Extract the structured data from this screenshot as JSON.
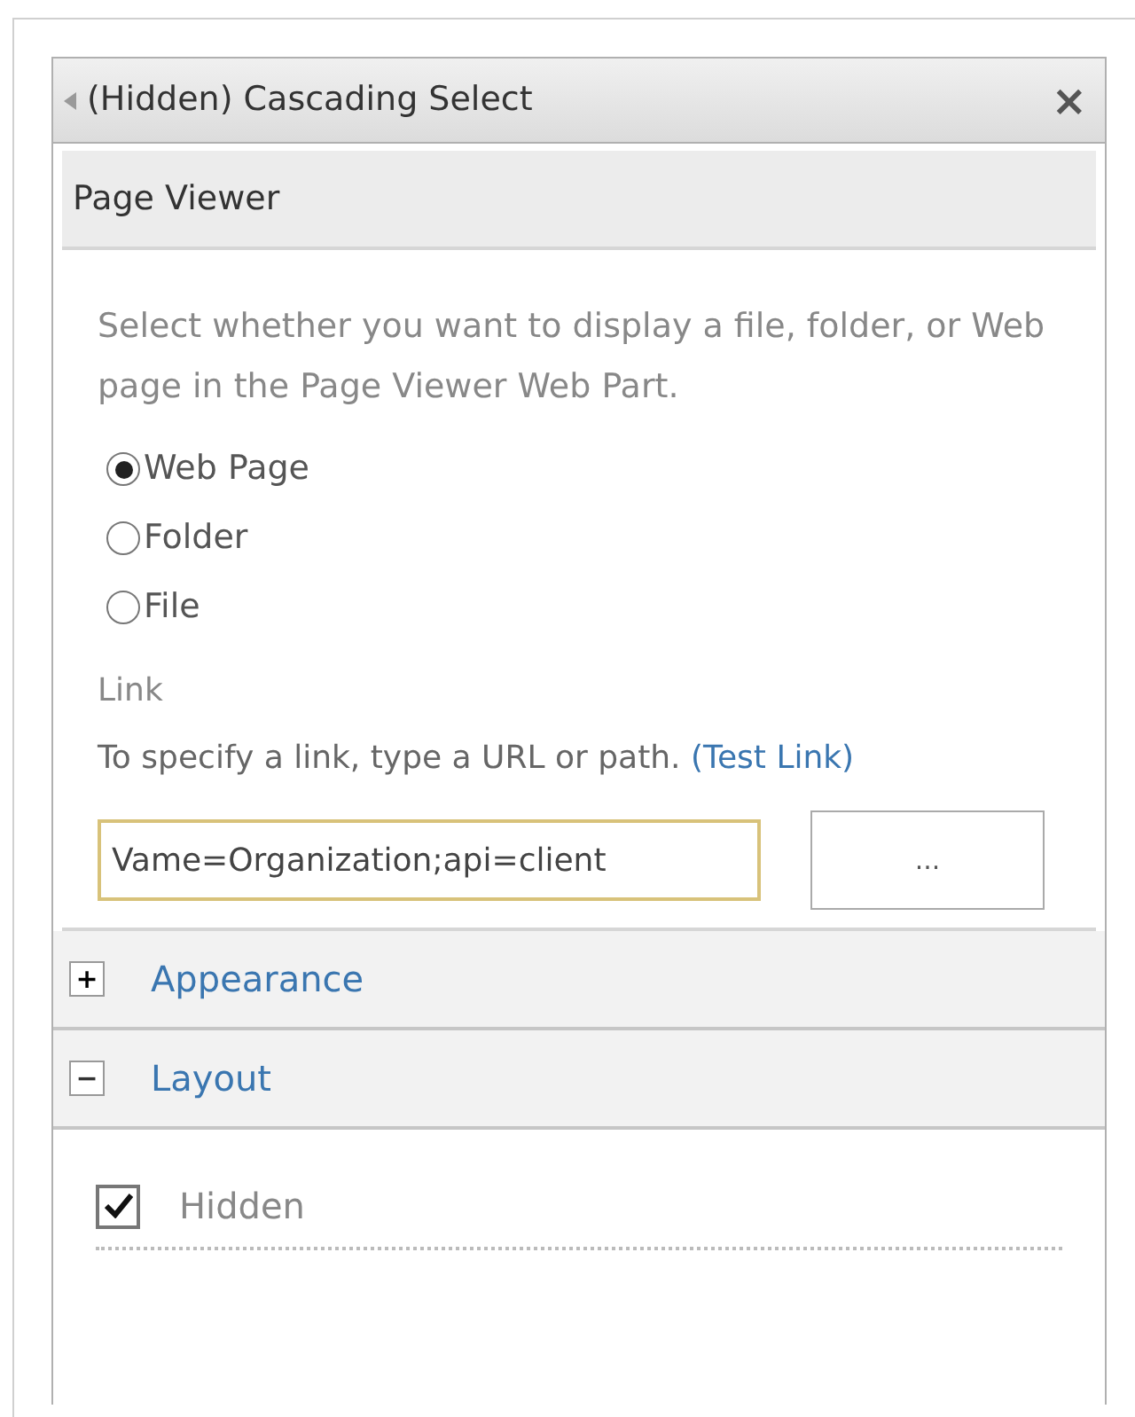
{
  "panel": {
    "title": "(Hidden) Cascading Select",
    "close": "×"
  },
  "section": {
    "title": "Page Viewer",
    "description": "Select whether you want to display a file, folder, or Web page in the Page Viewer Web Part."
  },
  "radios": [
    {
      "label": "Web Page",
      "selected": true
    },
    {
      "label": "Folder",
      "selected": false
    },
    {
      "label": "File",
      "selected": false
    }
  ],
  "link": {
    "label": "Link",
    "help": "To specify a link, type a URL or path.",
    "test_link": "(Test Link)",
    "value": "Vame=Organization;api=client",
    "browse": "..."
  },
  "groups": [
    {
      "title": "Appearance",
      "expanded": false,
      "toggle": "+"
    },
    {
      "title": "Layout",
      "expanded": true,
      "toggle": "−"
    }
  ],
  "options": [
    {
      "label": "Hidden",
      "checked": true
    }
  ]
}
